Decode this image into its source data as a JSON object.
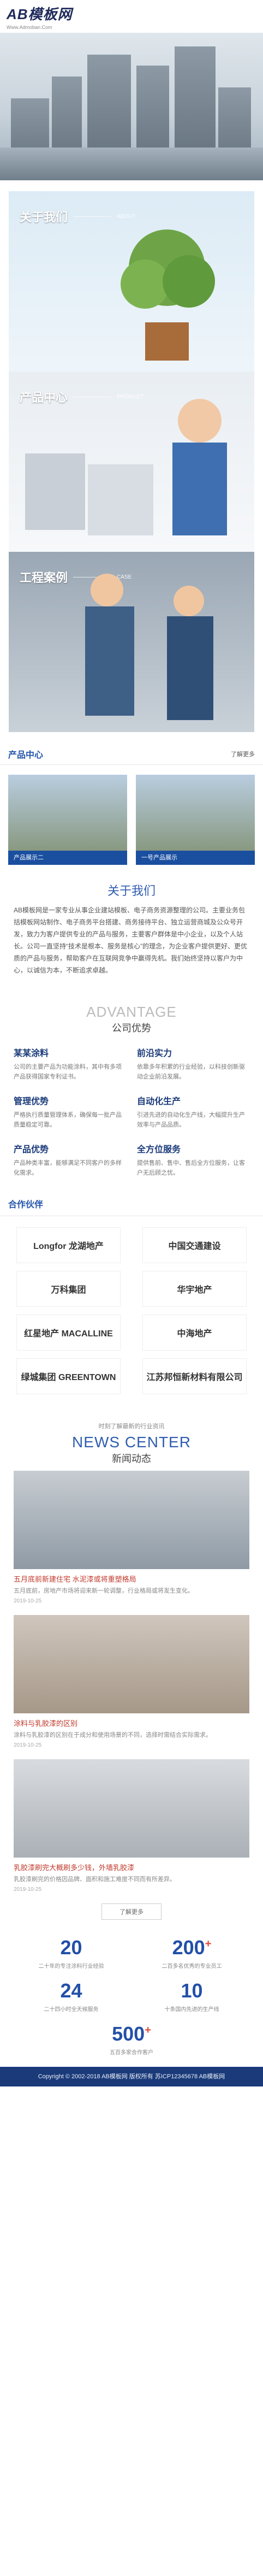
{
  "header": {
    "logo": "AB模板网",
    "sub": "Www.Admoban.Com"
  },
  "banners": [
    {
      "cn": "关于我们",
      "en": "ABOUT"
    },
    {
      "cn": "产品中心",
      "en": "PRODUCT"
    },
    {
      "cn": "工程案例",
      "en": "CASE"
    }
  ],
  "products": {
    "title": "产品中心",
    "more": "了解更多",
    "items": [
      {
        "caption": "产品展示二"
      },
      {
        "caption": "一号产品展示"
      }
    ]
  },
  "about": {
    "title": "关于我们",
    "text": "AB模板网是一家专业从事企业建站模板、电子商务资源整理的公司。主要业务包括模板网站制作、电子商务平台搭建、商务接待平台、独立运营商城及公众号开发，致力为客户提供专业的产品与服务，主要客户群体是中小企业，以及个人站长。公司一直坚持“技术是根本、服务是核心”的理念，为企业客户提供更好、更优质的产品与服务，帮助客户在互联网竞争中赢得先机。我们始终坚持以客户为中心，以诚信为本，不断追求卓越。"
  },
  "advantage": {
    "en": "ADVANTAGE",
    "cn": "公司优势",
    "items": [
      {
        "h": "某某涂料",
        "p": "公司的主要产品为功能涂料，其中有多项产品获得国家专利证书。"
      },
      {
        "h": "前沿实力",
        "p": "依靠多年积累的行业经验，以科技创新驱动企业前沿发展。"
      },
      {
        "h": "管理优势",
        "p": "严格执行质量管理体系，确保每一批产品质量稳定可靠。"
      },
      {
        "h": "自动化生产",
        "p": "引进先进的自动化生产线，大幅提升生产效率与产品品质。"
      },
      {
        "h": "产品优势",
        "p": "产品种类丰富，能够满足不同客户的多样化需求。"
      },
      {
        "h": "全方位服务",
        "p": "提供售前、售中、售后全方位服务，让客户无后顾之忧。"
      }
    ]
  },
  "partners": {
    "title": "合作伙伴",
    "items": [
      {
        "name": "Longfor 龙湖地产"
      },
      {
        "name": "中国交通建设"
      },
      {
        "name": "万科集团"
      },
      {
        "name": "华宇地产"
      },
      {
        "name": "红星地产 MACALLINE"
      },
      {
        "name": "中海地产"
      },
      {
        "name": "绿城集团 GREENTOWN"
      },
      {
        "name": "江苏邦恒新材料有限公司"
      }
    ]
  },
  "news": {
    "small": "时刻了解最新的行业资讯",
    "en": "NEWS CENTER",
    "cn": "新闻动态",
    "items": [
      {
        "title": "五月底前新建住宅 水泥漆或将重塑格局",
        "desc": "五月底前，房地产市场将迎来新一轮调整，行业格局或将发生变化。",
        "date": "2019-10-25"
      },
      {
        "title": "涂料与乳胶漆的区别",
        "desc": "涂料与乳胶漆的区别在于成分和使用场景的不同，选择时需结合实际需求。",
        "date": "2019-10-25"
      },
      {
        "title": "乳胶漆刷完大概刷多少钱，外墙乳胶漆",
        "desc": "乳胶漆刷完的价格因品牌、面积和施工难度不同而有所差异。",
        "date": "2019-10-25"
      }
    ],
    "more": "了解更多"
  },
  "stats": [
    {
      "num": "20",
      "sup": "",
      "lbl": "二十年的专注涂料行业经验"
    },
    {
      "num": "200",
      "sup": "+",
      "lbl": "二百多名优秀的专业员工"
    },
    {
      "num": "24",
      "sup": "",
      "lbl": "二十四小时全天候服务"
    },
    {
      "num": "10",
      "sup": "",
      "lbl": "十条国内先进的生产线"
    },
    {
      "num": "500",
      "sup": "+",
      "lbl": "五百多家合作客户"
    }
  ],
  "footer": "Copyright © 2002-2018 AB模板网 版权所有 苏ICP12345678 AB模板网"
}
